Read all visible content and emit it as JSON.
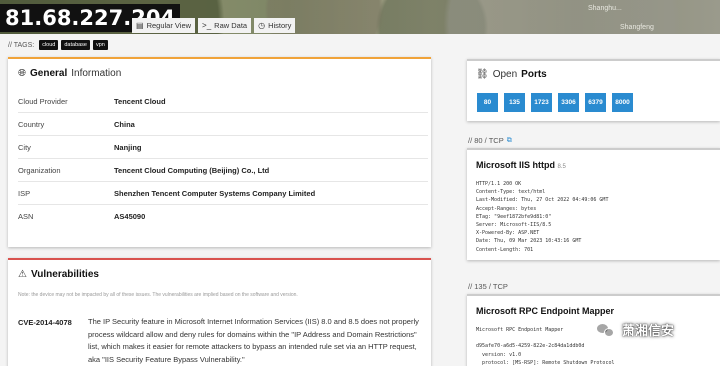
{
  "header": {
    "ip": "81.68.227.204",
    "map_labels": [
      "Shanghu...",
      "Shangfeng"
    ],
    "tabs": [
      {
        "label": "Regular View",
        "icon": "document-icon"
      },
      {
        "label": "Raw Data",
        "icon": "terminal-icon"
      },
      {
        "label": "History",
        "icon": "clock-icon"
      }
    ]
  },
  "tags": {
    "label": "// TAGS:",
    "items": [
      "cloud",
      "database",
      "vpn"
    ]
  },
  "general": {
    "title_bold": "General",
    "title_rest": "Information",
    "rows": [
      {
        "key": "Cloud Provider",
        "value": "Tencent Cloud"
      },
      {
        "key": "Country",
        "value": "China"
      },
      {
        "key": "City",
        "value": "Nanjing"
      },
      {
        "key": "Organization",
        "value": "Tencent Cloud Computing (Beijing) Co., Ltd"
      },
      {
        "key": "ISP",
        "value": "Shenzhen Tencent Computer Systems Company Limited"
      },
      {
        "key": "ASN",
        "value": "AS45090"
      }
    ]
  },
  "vulnerabilities": {
    "title": "Vulnerabilities",
    "note": "Note: the device may not be impacted by all of these issues. The vulnerabilities are implied based on the software and version.",
    "cve_id": "CVE-2014-4078",
    "cve_desc": "The IP Security feature in Microsoft Internet Information Services (IIS) 8.0 and 8.5 does not properly process wildcard allow and deny rules for domains within the \"IP Address and Domain Restrictions\" list, which makes it easier for remote attackers to bypass an intended rule set via an HTTP request, aka \"IIS Security Feature Bypass Vulnerability.\""
  },
  "open_ports": {
    "title": "Open",
    "title_bold": "Ports",
    "ports": [
      "80",
      "135",
      "1723",
      "3306",
      "6379",
      "8000"
    ]
  },
  "services": [
    {
      "label": "// 80 / TCP",
      "title": "Microsoft IIS httpd",
      "version": "8.5",
      "banner": "HTTP/1.1 200 OK\nContent-Type: text/html\nLast-Modified: Thu, 27 Oct 2022 04:49:06 GMT\nAccept-Ranges: bytes\nETag: \"9eef1872bfe9d81:0\"\nServer: Microsoft-IIS/8.5\nX-Powered-By: ASP.NET\nDate: Thu, 09 Mar 2023 10:43:16 GMT\nContent-Length: 701"
    },
    {
      "label": "// 135 / TCP",
      "title": "Microsoft RPC Endpoint Mapper",
      "version": "",
      "banner": "Microsoft RPC Endpoint Mapper\n\nd95afe70-a6d5-4259-822e-2c84da1ddb0d\n  version: v1.0\n  protocol: [MS-RSP]: Remote Shutdown Protocol"
    }
  ],
  "watermark": "萧湘信安"
}
